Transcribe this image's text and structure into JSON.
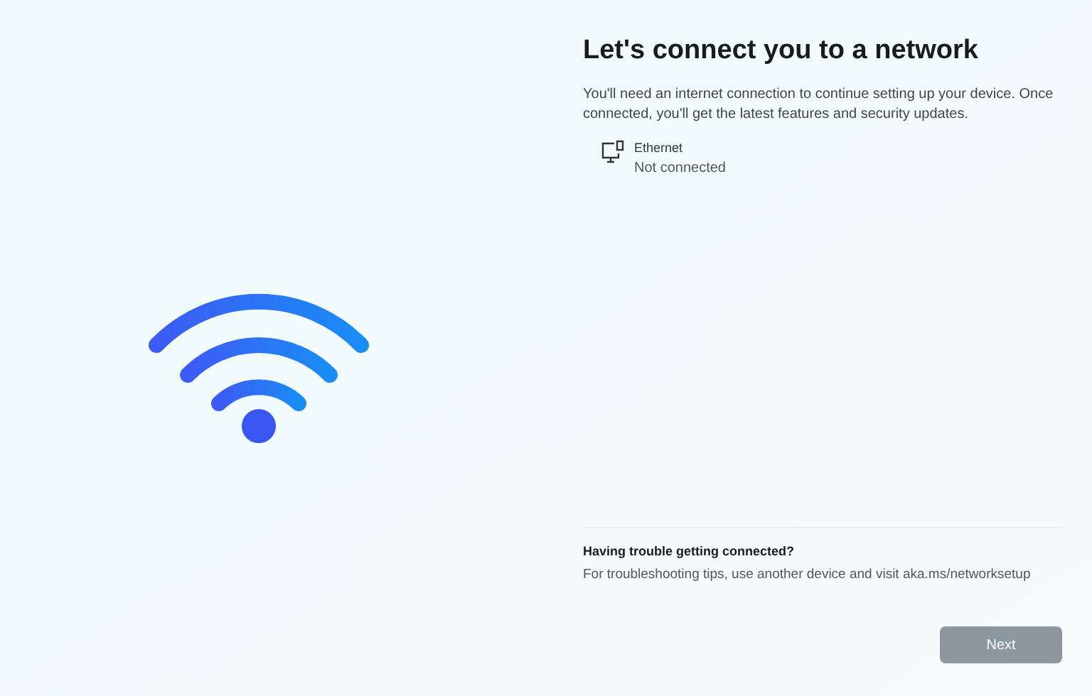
{
  "title": "Let's connect you to a network",
  "description": "You'll need an internet connection to continue setting up your device. Once connected, you'll get the latest features and security updates.",
  "networks": [
    {
      "name": "Ethernet",
      "status": "Not connected"
    }
  ],
  "help": {
    "heading": "Having trouble getting connected?",
    "text": "For troubleshooting tips, use another device and visit aka.ms/networksetup"
  },
  "next_button": {
    "label": "Next",
    "disabled": true
  }
}
